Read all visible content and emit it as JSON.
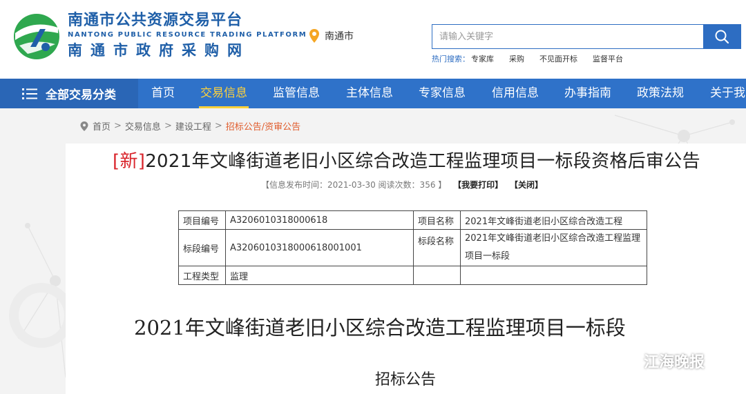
{
  "header": {
    "brand_cn": "南通市公共资源交易平台",
    "brand_en": "NANTONG PUBLIC RESOURCE TRADING PLATFORM",
    "brand_sub": "南通市政府采购网",
    "city": "南通市",
    "search_placeholder": "请输入关键字",
    "hot_label": "热门搜索：",
    "hot_items": [
      "专家库",
      "采购",
      "不见面开标",
      "监督平台"
    ]
  },
  "nav": {
    "all_label": "全部交易分类",
    "items": [
      "首页",
      "交易信息",
      "监管信息",
      "主体信息",
      "专家信息",
      "信用信息",
      "办事指南",
      "政策法规",
      "关于我"
    ],
    "active_index": 1
  },
  "breadcrumb": [
    "首页",
    "交易信息",
    "建设工程",
    "招标公告/资审公告"
  ],
  "article": {
    "tag": "[新]",
    "title": "2021年文峰街道老旧小区综合改造工程监理项目一标段资格后审公告",
    "meta": "【信息发布时间：2021-03-30 阅读次数：356 】",
    "print_label": "【我要打印】",
    "close_label": "【关闭】",
    "table": {
      "row1": [
        "项目编号",
        "A3206010318000618",
        "项目名称",
        "2021年文峰街道老旧小区综合改造工程"
      ],
      "row2": [
        "标段编号",
        "A3206010318000618001001",
        "标段名称",
        "2021年文峰街道老旧小区综合改造工程监理项目一标段"
      ],
      "row3": [
        "工程类型",
        "监理",
        "",
        ""
      ]
    },
    "doc_title": "2021年文峰街道老旧小区综合改造工程监理项目一标段",
    "doc_subtitle": "招标公告"
  },
  "watermark": "江海晚报",
  "colors": {
    "brand_blue": "#1f5fa8",
    "nav_blue": "#2f72c9",
    "active_yellow": "#ffd23a",
    "tag_red": "#d9242b",
    "crumb_orange": "#e05b2b"
  }
}
